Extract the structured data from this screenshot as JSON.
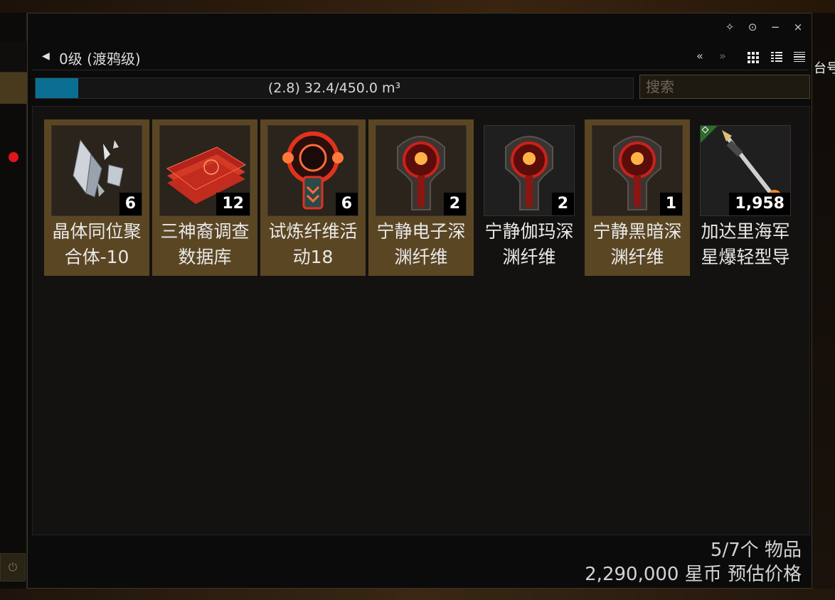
{
  "window": {
    "title": "0级 (渡鸦级)",
    "controls": [
      "✧",
      "⊙",
      "−",
      "×"
    ]
  },
  "nav": {
    "prev": "«",
    "next": "»"
  },
  "capacity": {
    "text": "(2.8) 32.4/450.0 m³",
    "fill_fraction": 0.072
  },
  "search": {
    "placeholder": "搜索",
    "value": ""
  },
  "right_label": "台号",
  "items": [
    {
      "name": "晶体同位聚合体-10",
      "qty": "6",
      "icon": "crystal-shards-icon",
      "selected": true
    },
    {
      "name": "三神裔调查数据库",
      "qty": "12",
      "icon": "data-tablets-icon",
      "selected": true
    },
    {
      "name": "试炼纤维活动18",
      "qty": "6",
      "icon": "trial-filament-icon",
      "selected": true
    },
    {
      "name": "宁静电子深渊纤维",
      "qty": "2",
      "icon": "abyssal-filament-icon",
      "selected": true
    },
    {
      "name": "宁静伽玛深渊纤维",
      "qty": "2",
      "icon": "abyssal-filament-icon",
      "selected": false
    },
    {
      "name": "宁静黑暗深渊纤维",
      "qty": "1",
      "icon": "abyssal-filament-icon",
      "selected": true
    },
    {
      "name": "加达里海军星爆轻型导",
      "qty": "1,958",
      "icon": "light-missile-icon",
      "selected": false
    }
  ],
  "footer": {
    "count": "5/7个 物品",
    "estimated_price": "2,290,000 星币 预估价格"
  },
  "colors": {
    "accent_gold": "#5b4624",
    "capacity_fill": "#0b6f94",
    "alert_dot": "#e3141b"
  }
}
